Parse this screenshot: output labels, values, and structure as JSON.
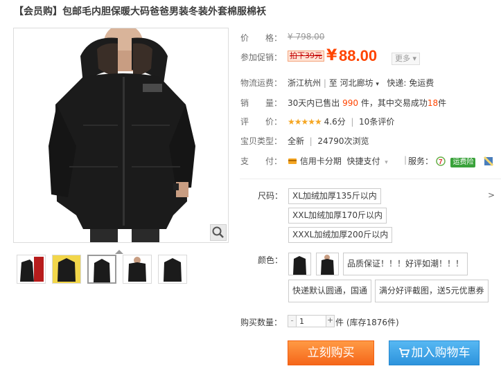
{
  "title": "【会员购】包邮毛内胆保暖大码爸爸男装冬装外套棉服棉袄",
  "price": {
    "label": "价　　格：",
    "original": "¥ 798.00"
  },
  "promo": {
    "label": "参加促销：",
    "badge": "拍下39元",
    "currency": "¥",
    "price": "88.00",
    "more_label": "更多"
  },
  "shipping": {
    "label": "物流运费：",
    "origin": "浙江杭州",
    "separator": "|",
    "to_label": "至",
    "destination": "河北廊坊",
    "express": "快递: 免运费"
  },
  "sales": {
    "label": "销　　量：",
    "prefix": "30天内已售出",
    "sold": "990",
    "middle": "件，其中交易成功",
    "success": "18",
    "suffix": "件"
  },
  "rating": {
    "label": "评　　价：",
    "stars": "★★★★★",
    "score": "4.6分",
    "separator": "|",
    "reviews": "10条评价"
  },
  "item_type": {
    "label": "宝贝类型：",
    "condition": "全新",
    "separator": "|",
    "views": "24790次浏览"
  },
  "payment": {
    "label": "支　　付：",
    "method1": "信用卡分期",
    "method2": "快捷支付",
    "services_label": "服务：",
    "insurance": "运费险"
  },
  "size": {
    "label": "尺码：",
    "options": [
      "XL加绒加厚135斤以内",
      "XXL加绒加厚170斤以内",
      "XXXL加绒加厚200斤以内"
    ],
    "arrow": ">"
  },
  "color": {
    "label": "颜色：",
    "options": [
      "品质保证！！！好评如潮！！！",
      "快递默认圆通，国通",
      "满分好评截图，送5元优惠券"
    ]
  },
  "quantity": {
    "label": "购买数量：",
    "minus": "-",
    "value": "1",
    "plus": "+",
    "stock": "件 (库存1876件)"
  },
  "actions": {
    "buy_now": "立刻购买",
    "add_to_cart": "加入购物车"
  },
  "colors": {
    "price": "#ff4400",
    "buy": "#f5661a",
    "cart": "#2d93dc"
  }
}
